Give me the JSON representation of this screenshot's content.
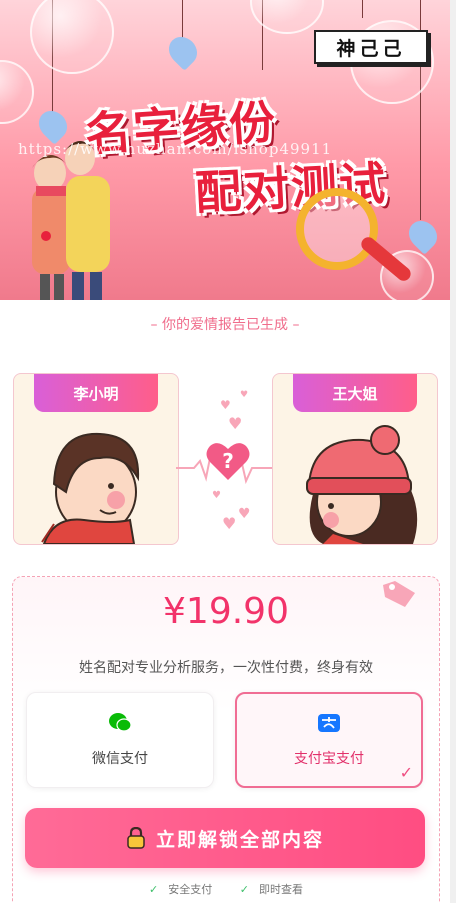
{
  "banner": {
    "logo": "神己己",
    "title_line1": "名字缘份",
    "title_line2": "配对测试",
    "watermark": "https://www.huzhan.com/ishop49911"
  },
  "report": {
    "caption": "– 你的爱情报告已生成 –"
  },
  "pair": {
    "left_name": "李小明",
    "right_name": "王大姐",
    "heart_symbol": "?"
  },
  "payment": {
    "price": "¥19.90",
    "description": "姓名配对专业分析服务，一次性付费，终身有效",
    "wechat_label": "微信支付",
    "alipay_label": "支付宝支付",
    "selected_check": "✓",
    "unlock_label": "立即解锁全部内容",
    "assurance": [
      "安全支付",
      "即时查看"
    ],
    "colors": {
      "accent": "#ff4d82",
      "price": "#f2336a",
      "wechat": "#09bb07",
      "alipay": "#1677ff"
    }
  }
}
